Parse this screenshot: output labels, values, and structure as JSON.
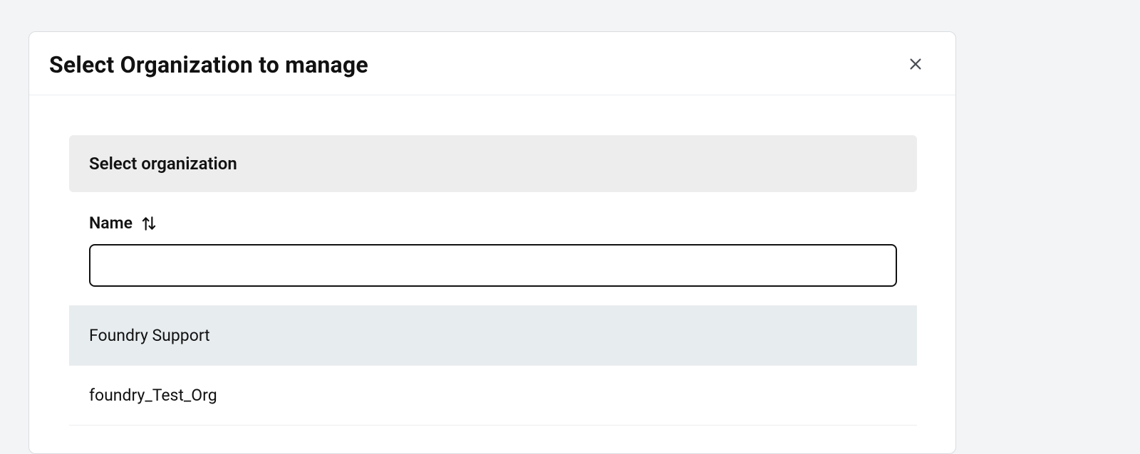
{
  "dialog": {
    "title": "Select Organization to manage",
    "section_header": "Select organization",
    "column": {
      "label": "Name"
    },
    "search": {
      "value": "",
      "placeholder": ""
    },
    "items": [
      {
        "label": "Foundry Support",
        "selected": true
      },
      {
        "label": "foundry_Test_Org",
        "selected": false
      }
    ]
  }
}
